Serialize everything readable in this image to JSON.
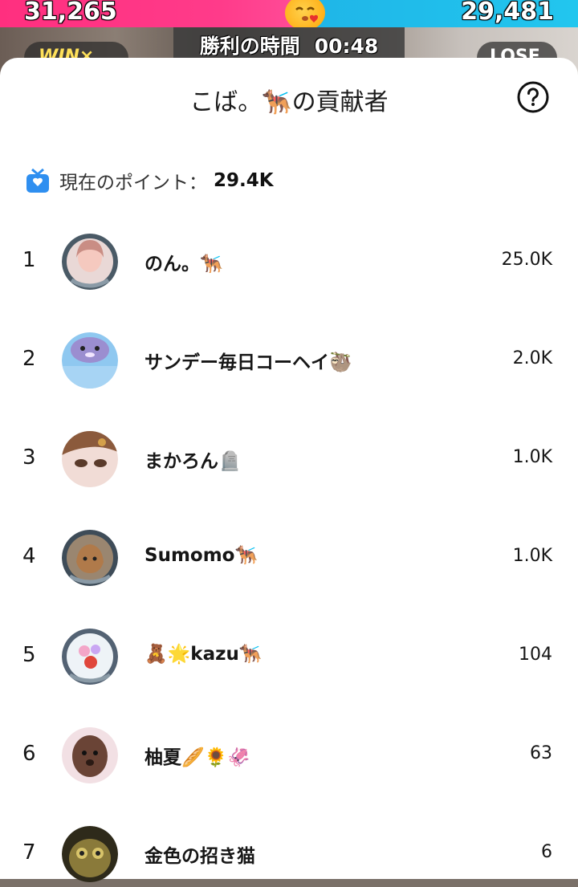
{
  "battle": {
    "left_score": "31,265",
    "right_score": "29,481",
    "timer_label": "勝利の時間",
    "timer_value": "00:48",
    "win_label": "WIN×",
    "lose_label": "LOSE",
    "left_color": "#ff3b8a",
    "right_color": "#22c6ee"
  },
  "sheet": {
    "title": "こば。🐕‍🦺の貢献者",
    "help_icon": "question-circle-icon",
    "points_label": "現在のポイント：",
    "points_value": "29.4K",
    "points_icon": "gift-box-icon"
  },
  "contributors": [
    {
      "rank": "1",
      "name": "のん。🐕‍🦺",
      "score": "25.0K",
      "avatar": "girl-photo"
    },
    {
      "rank": "2",
      "name": "サンデー毎日コーヘイ🦥",
      "score": "2.0K",
      "avatar": "seal-plush"
    },
    {
      "rank": "3",
      "name": "まかろん🪦",
      "score": "1.0K",
      "avatar": "girl-closeup"
    },
    {
      "rank": "4",
      "name": "Sumomo🐕‍🦺",
      "score": "1.0K",
      "avatar": "cat-photo"
    },
    {
      "rank": "5",
      "name": "🧸🌟kazu🐕‍🦺",
      "score": "104",
      "avatar": "flower-bear"
    },
    {
      "rank": "6",
      "name": "柚夏🥖🌻🦑",
      "score": "63",
      "avatar": "puppy-photo"
    },
    {
      "rank": "7",
      "name": "金色の招き猫",
      "score": "6",
      "avatar": "golden-cat"
    }
  ]
}
